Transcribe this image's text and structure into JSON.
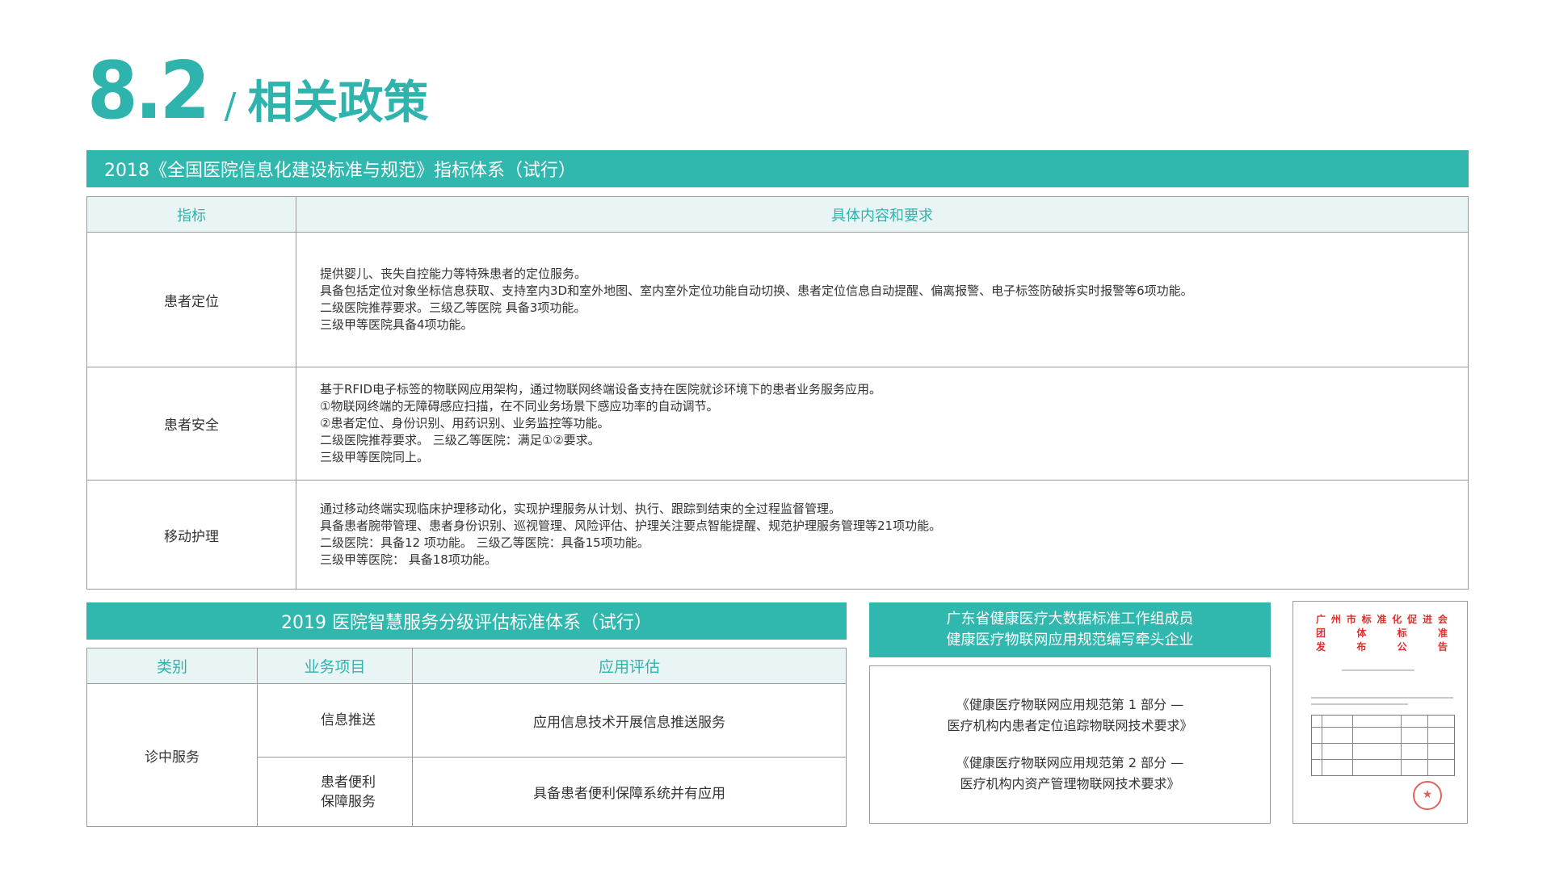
{
  "header": {
    "number": "8.2",
    "slash": "/",
    "title": "相关政策"
  },
  "section1": {
    "banner": "2018《全国医院信息化建设标准与规范》指标体系（试行）",
    "columns": [
      "指标",
      "具体内容和要求"
    ],
    "rows": [
      {
        "indicator": "患者定位",
        "lines": [
          "提供婴儿、丧失自控能力等特殊患者的定位服务。",
          "具备包括定位对象坐标信息获取、支持室内3D和室外地图、室内室外定位功能自动切换、患者定位信息自动提醒、偏离报警、电子标签防破拆实时报警等6项功能。",
          "二级医院推荐要求。三级乙等医院 具备3项功能。",
          "三级甲等医院具备4项功能。"
        ]
      },
      {
        "indicator": "患者安全",
        "lines": [
          "基于RFID电子标签的物联网应用架构，通过物联网终端设备支持在医院就诊环境下的患者业务服务应用。",
          "①物联网终端的无障碍感应扫描，在不同业务场景下感应功率的自动调节。",
          "②患者定位、身份识别、用药识别、业务监控等功能。",
          "二级医院推荐要求。 三级乙等医院：满足①②要求。",
          "三级甲等医院同上。"
        ]
      },
      {
        "indicator": "移动护理",
        "lines": [
          "通过移动终端实现临床护理移动化，实现护理服务从计划、执行、跟踪到结束的全过程监督管理。",
          "具备患者腕带管理、患者身份识别、巡视管理、风险评估、护理关注要点智能提醒、规范护理服务管理等21项功能。",
          "二级医院：具备12 项功能。 三级乙等医院：具备15项功能。",
          "三级甲等医院： 具备18项功能。"
        ]
      }
    ]
  },
  "section2": {
    "banner": "2019 医院智慧服务分级评估标准体系（试行）",
    "columns": [
      "类别",
      "业务项目",
      "应用评估"
    ],
    "category": "诊中服务",
    "rows": [
      {
        "item_lines": [
          "信息推送"
        ],
        "evaluation": "应用信息技术开展信息推送服务"
      },
      {
        "item_lines": [
          "患者便利",
          "保障服务"
        ],
        "evaluation": "具备患者便利保障系统并有应用"
      }
    ]
  },
  "section3": {
    "banner_lines": [
      "广东省健康医疗大数据标准工作组成员",
      "健康医疗物联网应用规范编写牵头企业"
    ],
    "docs": [
      [
        "《健康医疗物联网应用规范第 1 部分 —",
        "医疗机构内患者定位追踪物联网技术要求》"
      ],
      [
        "《健康医疗物联网应用规范第 2 部分 —",
        "医疗机构内资产管理物联网技术要求》"
      ]
    ]
  },
  "announcement": {
    "header_rows": [
      [
        "广",
        "州",
        "市",
        "标",
        "准",
        "化",
        "促",
        "进",
        "会"
      ],
      [
        "团",
        "体",
        "标",
        "准"
      ],
      [
        "发",
        "布",
        "公",
        "告"
      ]
    ]
  },
  "colors": {
    "accent": "#30b7ae",
    "header_bg": "#e9f5f4",
    "seal": "#d9332f"
  }
}
